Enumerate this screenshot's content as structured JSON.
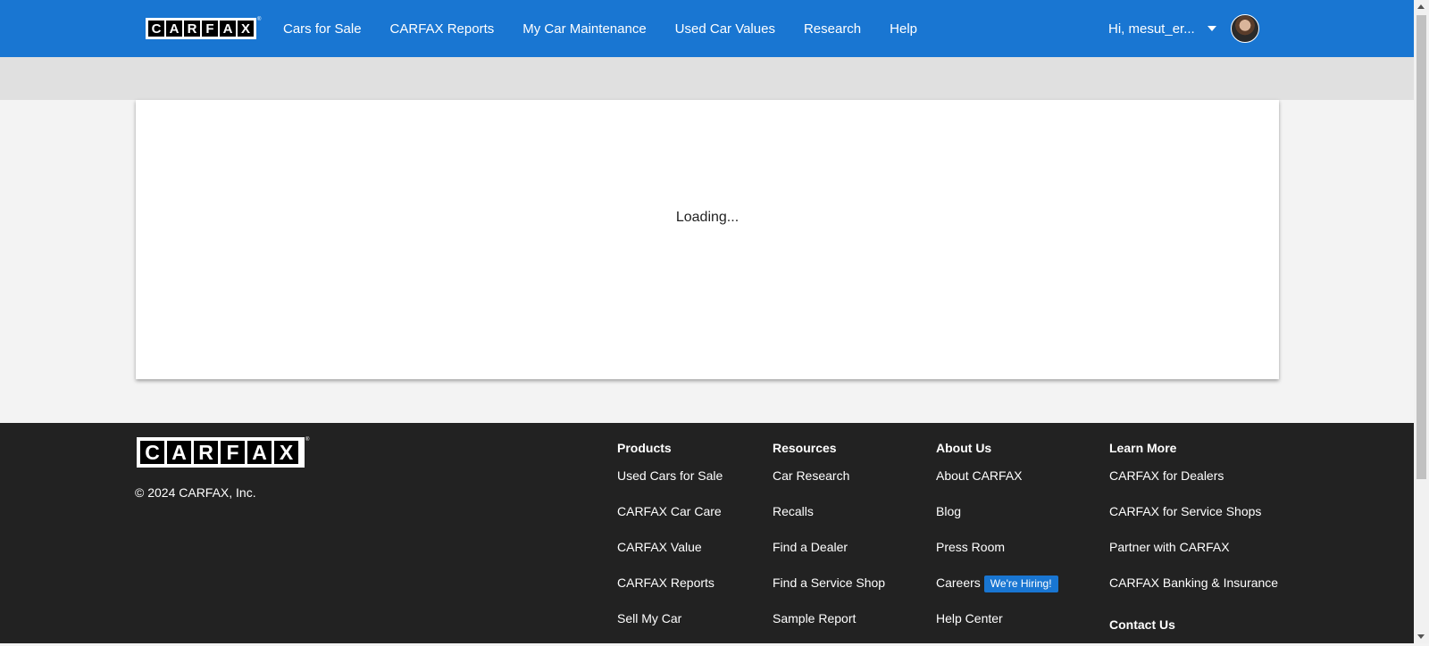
{
  "header": {
    "logo_letters": [
      "C",
      "A",
      "R",
      "F",
      "A",
      "X"
    ],
    "nav": [
      {
        "label": "Cars for Sale"
      },
      {
        "label": "CARFAX Reports"
      },
      {
        "label": "My Car Maintenance"
      },
      {
        "label": "Used Car Values"
      },
      {
        "label": "Research"
      },
      {
        "label": "Help"
      }
    ],
    "user_greeting": "Hi, mesut_er...",
    "brand_color": "#1976d2"
  },
  "main": {
    "loading_text": "Loading..."
  },
  "footer": {
    "copyright": "© 2024 CARFAX, Inc.",
    "columns": [
      {
        "heading": "Products",
        "links": [
          "Used Cars for Sale",
          "CARFAX Car Care",
          "CARFAX Value",
          "CARFAX Reports",
          "Sell My Car"
        ]
      },
      {
        "heading": "Resources",
        "links": [
          "Car Research",
          "Recalls",
          "Find a Dealer",
          "Find a Service Shop",
          "Sample Report"
        ]
      },
      {
        "heading": "About Us",
        "links": [
          "About CARFAX",
          "Blog",
          "Press Room",
          "Careers",
          "Help Center"
        ],
        "careers_badge": "We're Hiring!"
      },
      {
        "heading": "Learn More",
        "links": [
          "CARFAX for Dealers",
          "CARFAX for Service Shops",
          "Partner with CARFAX",
          "CARFAX Banking & Insurance"
        ],
        "extra_heading": "Contact Us"
      }
    ],
    "background_color": "#222222"
  }
}
